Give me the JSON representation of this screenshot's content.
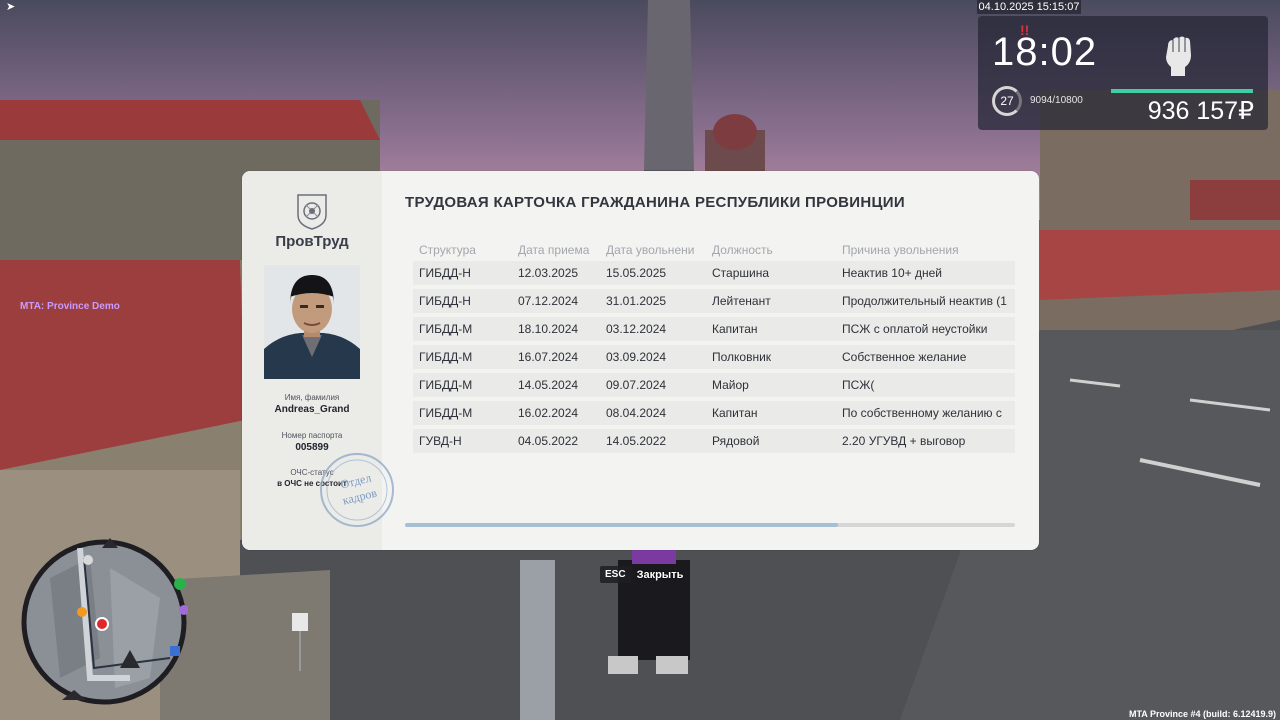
{
  "hud": {
    "timestamp": "04.10.2025 15:15:07",
    "clock": "18:02",
    "alert": "!!",
    "level": "27",
    "xp": "9094/10800",
    "money": "936 157₽",
    "icon": "fist-icon",
    "hp_color": "#3ed0a0",
    "hp_fraction": 1.0
  },
  "server_label": "MTA: Province Demo",
  "build_label": "MTA Province #4 (build: 6.12419.9)",
  "card": {
    "org_name": "ПровТруд",
    "name_label": "Имя, фамилия",
    "name_value": "Andreas_Grand",
    "passport_label": "Номер паспорта",
    "passport_value": "005899",
    "ochs_label": "ОЧС-статус",
    "ochs_value": "в ОЧС не состоит",
    "stamp_line1": "Отдел",
    "stamp_line2": "кадров",
    "title": "ТРУДОВАЯ КАРТОЧКА ГРАЖДАНИНА РЕСПУБЛИКИ ПРОВИНЦИИ",
    "columns": [
      "Структура",
      "Дата приема",
      "Дата увольнени",
      "Должность",
      "Причина увольнения"
    ],
    "rows": [
      [
        "ГИБДД-Н",
        "12.03.2025",
        "15.05.2025",
        "Старшина",
        "Неактив 10+ дней"
      ],
      [
        "ГИБДД-Н",
        "07.12.2024",
        "31.01.2025",
        "Лейтенант",
        "Продолжительный неактив (1"
      ],
      [
        "ГИБДД-М",
        "18.10.2024",
        "03.12.2024",
        "Капитан",
        "ПСЖ с оплатой неустойки"
      ],
      [
        "ГИБДД-М",
        "16.07.2024",
        "03.09.2024",
        "Полковник",
        "Собственное желание"
      ],
      [
        "ГИБДД-М",
        "14.05.2024",
        "09.07.2024",
        "Майор",
        "ПСЖ("
      ],
      [
        "ГИБДД-М",
        "16.02.2024",
        "08.04.2024",
        "Капитан",
        "По собственному желанию с"
      ],
      [
        "ГУВД-Н",
        "04.05.2022",
        "14.05.2022",
        "Рядовой",
        "2.20 УГУВД + выговор"
      ]
    ],
    "scroll_fraction": 0.71,
    "scroll_color": "#a6bed6"
  },
  "close_hint": {
    "key": "ESC",
    "label": "Закрыть"
  }
}
